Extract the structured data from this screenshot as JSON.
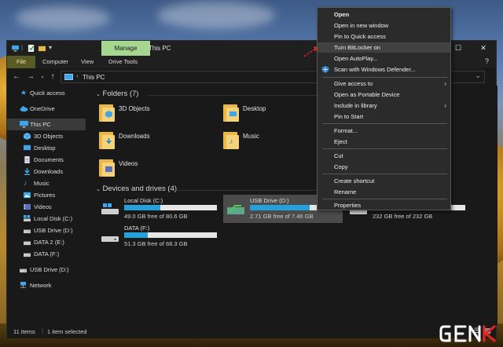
{
  "window": {
    "manage_tab": "Manage",
    "title": "This PC",
    "ribbon_tabs": [
      "File",
      "Computer",
      "View",
      "Drive Tools"
    ]
  },
  "address": {
    "location": "This PC"
  },
  "sidebar": {
    "items": [
      {
        "label": "Quick access",
        "icon": "star-icon"
      },
      {
        "label": "OneDrive",
        "icon": "cloud-icon"
      },
      {
        "label": "This PC",
        "icon": "pc-icon"
      },
      {
        "label": "3D Objects",
        "icon": "cube-icon"
      },
      {
        "label": "Desktop",
        "icon": "desktop-icon"
      },
      {
        "label": "Documents",
        "icon": "document-icon"
      },
      {
        "label": "Downloads",
        "icon": "download-icon"
      },
      {
        "label": "Music",
        "icon": "music-icon"
      },
      {
        "label": "Pictures",
        "icon": "picture-icon"
      },
      {
        "label": "Videos",
        "icon": "video-icon"
      },
      {
        "label": "Local Disk (C:)",
        "icon": "drive-icon"
      },
      {
        "label": "USB Drive (D:)",
        "icon": "usb-drive-icon"
      },
      {
        "label": "DATA 2 (E:)",
        "icon": "drive-icon"
      },
      {
        "label": "DATA (F:)",
        "icon": "drive-icon"
      },
      {
        "label": "USB Drive (D:)",
        "icon": "usb-drive-icon"
      },
      {
        "label": "Network",
        "icon": "network-icon"
      }
    ]
  },
  "content": {
    "folders_header": "Folders (7)",
    "folders": [
      "3D Objects",
      "Desktop",
      "Downloads",
      "Music",
      "Videos"
    ],
    "drives_header": "Devices and drives (4)",
    "drives": [
      {
        "name": "Local Disk (C:)",
        "free": "49.0 GB free of 80.6 GB",
        "used_fraction": 0.39
      },
      {
        "name": "USB Drive (D:)",
        "free": "2.71 GB free of 7.46 GB",
        "used_fraction": 0.64
      },
      {
        "name": "",
        "free": "232 GB free of 232 GB",
        "used_fraction": 0.0
      },
      {
        "name": "DATA (F:)",
        "free": "51.3 GB free of 68.3 GB",
        "used_fraction": 0.25
      }
    ]
  },
  "status": {
    "items": "11 items",
    "selected": "1 item selected"
  },
  "context_menu": {
    "items": [
      {
        "label": "Open",
        "bold": true
      },
      {
        "label": "Open in new window"
      },
      {
        "label": "Pin to Quick access"
      },
      {
        "label": "Turn BitLocker on"
      },
      {
        "label": "Open AutoPlay..."
      },
      {
        "label": "Scan with Windows Defender..."
      },
      {
        "label": "Give access to",
        "submenu": true
      },
      {
        "label": "Open as Portable Device"
      },
      {
        "label": "Include in library",
        "submenu": true
      },
      {
        "label": "Pin to Start"
      },
      {
        "label": "Format..."
      },
      {
        "label": "Eject"
      },
      {
        "label": "Cut"
      },
      {
        "label": "Copy"
      },
      {
        "label": "Create shortcut"
      },
      {
        "label": "Rename"
      },
      {
        "label": "Properties"
      }
    ]
  },
  "watermark": "GENK",
  "colors": {
    "manage_tab": "#a5d790",
    "accent_blue": "#26a0da",
    "window_bg": "#191919",
    "menu_bg": "#2b2b2b",
    "annotation_red": "#e0261f"
  }
}
